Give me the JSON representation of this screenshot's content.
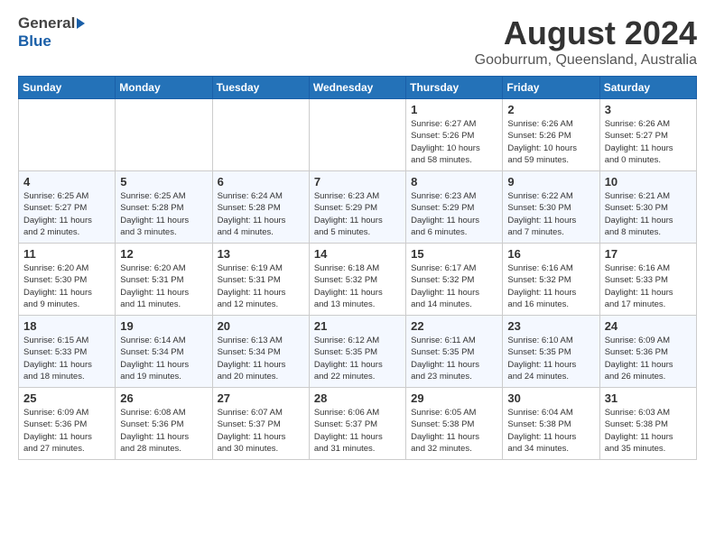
{
  "header": {
    "logo_general": "General",
    "logo_blue": "Blue",
    "month_title": "August 2024",
    "location": "Gooburrum, Queensland, Australia"
  },
  "days_of_week": [
    "Sunday",
    "Monday",
    "Tuesday",
    "Wednesday",
    "Thursday",
    "Friday",
    "Saturday"
  ],
  "weeks": [
    [
      {
        "day": "",
        "info": ""
      },
      {
        "day": "",
        "info": ""
      },
      {
        "day": "",
        "info": ""
      },
      {
        "day": "",
        "info": ""
      },
      {
        "day": "1",
        "info": "Sunrise: 6:27 AM\nSunset: 5:26 PM\nDaylight: 10 hours\nand 58 minutes."
      },
      {
        "day": "2",
        "info": "Sunrise: 6:26 AM\nSunset: 5:26 PM\nDaylight: 10 hours\nand 59 minutes."
      },
      {
        "day": "3",
        "info": "Sunrise: 6:26 AM\nSunset: 5:27 PM\nDaylight: 11 hours\nand 0 minutes."
      }
    ],
    [
      {
        "day": "4",
        "info": "Sunrise: 6:25 AM\nSunset: 5:27 PM\nDaylight: 11 hours\nand 2 minutes."
      },
      {
        "day": "5",
        "info": "Sunrise: 6:25 AM\nSunset: 5:28 PM\nDaylight: 11 hours\nand 3 minutes."
      },
      {
        "day": "6",
        "info": "Sunrise: 6:24 AM\nSunset: 5:28 PM\nDaylight: 11 hours\nand 4 minutes."
      },
      {
        "day": "7",
        "info": "Sunrise: 6:23 AM\nSunset: 5:29 PM\nDaylight: 11 hours\nand 5 minutes."
      },
      {
        "day": "8",
        "info": "Sunrise: 6:23 AM\nSunset: 5:29 PM\nDaylight: 11 hours\nand 6 minutes."
      },
      {
        "day": "9",
        "info": "Sunrise: 6:22 AM\nSunset: 5:30 PM\nDaylight: 11 hours\nand 7 minutes."
      },
      {
        "day": "10",
        "info": "Sunrise: 6:21 AM\nSunset: 5:30 PM\nDaylight: 11 hours\nand 8 minutes."
      }
    ],
    [
      {
        "day": "11",
        "info": "Sunrise: 6:20 AM\nSunset: 5:30 PM\nDaylight: 11 hours\nand 9 minutes."
      },
      {
        "day": "12",
        "info": "Sunrise: 6:20 AM\nSunset: 5:31 PM\nDaylight: 11 hours\nand 11 minutes."
      },
      {
        "day": "13",
        "info": "Sunrise: 6:19 AM\nSunset: 5:31 PM\nDaylight: 11 hours\nand 12 minutes."
      },
      {
        "day": "14",
        "info": "Sunrise: 6:18 AM\nSunset: 5:32 PM\nDaylight: 11 hours\nand 13 minutes."
      },
      {
        "day": "15",
        "info": "Sunrise: 6:17 AM\nSunset: 5:32 PM\nDaylight: 11 hours\nand 14 minutes."
      },
      {
        "day": "16",
        "info": "Sunrise: 6:16 AM\nSunset: 5:32 PM\nDaylight: 11 hours\nand 16 minutes."
      },
      {
        "day": "17",
        "info": "Sunrise: 6:16 AM\nSunset: 5:33 PM\nDaylight: 11 hours\nand 17 minutes."
      }
    ],
    [
      {
        "day": "18",
        "info": "Sunrise: 6:15 AM\nSunset: 5:33 PM\nDaylight: 11 hours\nand 18 minutes."
      },
      {
        "day": "19",
        "info": "Sunrise: 6:14 AM\nSunset: 5:34 PM\nDaylight: 11 hours\nand 19 minutes."
      },
      {
        "day": "20",
        "info": "Sunrise: 6:13 AM\nSunset: 5:34 PM\nDaylight: 11 hours\nand 20 minutes."
      },
      {
        "day": "21",
        "info": "Sunrise: 6:12 AM\nSunset: 5:35 PM\nDaylight: 11 hours\nand 22 minutes."
      },
      {
        "day": "22",
        "info": "Sunrise: 6:11 AM\nSunset: 5:35 PM\nDaylight: 11 hours\nand 23 minutes."
      },
      {
        "day": "23",
        "info": "Sunrise: 6:10 AM\nSunset: 5:35 PM\nDaylight: 11 hours\nand 24 minutes."
      },
      {
        "day": "24",
        "info": "Sunrise: 6:09 AM\nSunset: 5:36 PM\nDaylight: 11 hours\nand 26 minutes."
      }
    ],
    [
      {
        "day": "25",
        "info": "Sunrise: 6:09 AM\nSunset: 5:36 PM\nDaylight: 11 hours\nand 27 minutes."
      },
      {
        "day": "26",
        "info": "Sunrise: 6:08 AM\nSunset: 5:36 PM\nDaylight: 11 hours\nand 28 minutes."
      },
      {
        "day": "27",
        "info": "Sunrise: 6:07 AM\nSunset: 5:37 PM\nDaylight: 11 hours\nand 30 minutes."
      },
      {
        "day": "28",
        "info": "Sunrise: 6:06 AM\nSunset: 5:37 PM\nDaylight: 11 hours\nand 31 minutes."
      },
      {
        "day": "29",
        "info": "Sunrise: 6:05 AM\nSunset: 5:38 PM\nDaylight: 11 hours\nand 32 minutes."
      },
      {
        "day": "30",
        "info": "Sunrise: 6:04 AM\nSunset: 5:38 PM\nDaylight: 11 hours\nand 34 minutes."
      },
      {
        "day": "31",
        "info": "Sunrise: 6:03 AM\nSunset: 5:38 PM\nDaylight: 11 hours\nand 35 minutes."
      }
    ]
  ]
}
